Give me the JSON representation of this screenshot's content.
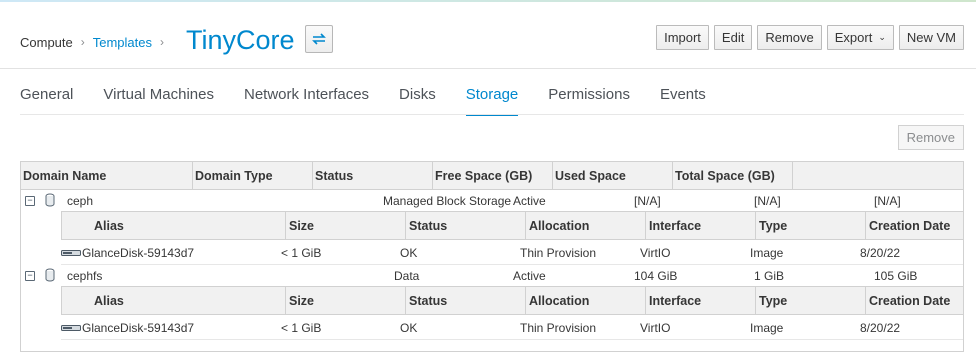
{
  "breadcrumb": {
    "home": "Compute",
    "link": "Templates",
    "title": "TinyCore"
  },
  "actions": {
    "import": "Import",
    "edit": "Edit",
    "remove": "Remove",
    "export": "Export",
    "new_vm": "New VM"
  },
  "tabs": [
    "General",
    "Virtual Machines",
    "Network Interfaces",
    "Disks",
    "Storage",
    "Permissions",
    "Events"
  ],
  "active_tab": "Storage",
  "remove_label": "Remove",
  "grid": {
    "columns": [
      "Domain Name",
      "Domain Type",
      "Status",
      "Free Space (GB)",
      "Used Space",
      "Total Space (GB)"
    ],
    "sub_columns": [
      "Alias",
      "Size",
      "Status",
      "Allocation",
      "Interface",
      "Type",
      "Creation Date"
    ],
    "domains": [
      {
        "name": "ceph",
        "type": "Managed Block Storage",
        "status": "Active",
        "free": "[N/A]",
        "used": "[N/A]",
        "total": "[N/A]",
        "disks": [
          {
            "alias": "GlanceDisk-59143d7",
            "size": "< 1 GiB",
            "status": "OK",
            "allocation": "Thin Provision",
            "interface": "VirtIO",
            "type": "Image",
            "created": "8/20/22"
          }
        ]
      },
      {
        "name": "cephfs",
        "type": "Data",
        "status": "Active",
        "free": "104 GiB",
        "used": "1 GiB",
        "total": "105 GiB",
        "disks": [
          {
            "alias": "GlanceDisk-59143d7",
            "size": "< 1 GiB",
            "status": "OK",
            "allocation": "Thin Provision",
            "interface": "VirtIO",
            "type": "Image",
            "created": "8/20/22"
          }
        ]
      }
    ]
  }
}
